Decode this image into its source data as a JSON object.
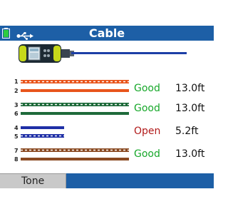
{
  "header": {
    "title": "Cable",
    "battery_icon": "battery-icon",
    "usb_icon": "usb-icon"
  },
  "device": {
    "icon": "cable-tester-device-icon"
  },
  "colors": {
    "header": "#1d5fa6",
    "good": "#18a82b",
    "open": "#b11a1a",
    "orange": "#e8551c",
    "green": "#1e6a3a",
    "blue": "#1f2fa6",
    "brown": "#8a4a22"
  },
  "pairs": [
    {
      "pin_a": "1",
      "pin_b": "2",
      "status": "Good",
      "length": "13.0ft",
      "color": "orange",
      "length_ratio": 1.0
    },
    {
      "pin_a": "3",
      "pin_b": "6",
      "status": "Good",
      "length": "13.0ft",
      "color": "green",
      "length_ratio": 1.0
    },
    {
      "pin_a": "4",
      "pin_b": "5",
      "status": "Open",
      "length": "5.2ft",
      "color": "blue",
      "length_ratio": 0.4
    },
    {
      "pin_a": "7",
      "pin_b": "8",
      "status": "Good",
      "length": "13.0ft",
      "color": "brown",
      "length_ratio": 1.0
    }
  ],
  "footer": {
    "tone_label": "Tone"
  }
}
